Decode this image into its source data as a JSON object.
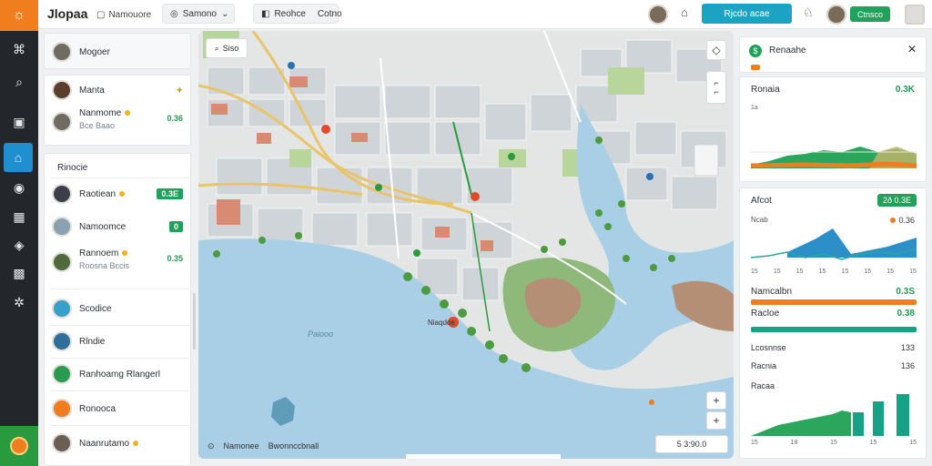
{
  "app": {
    "title": "Jlopaa"
  },
  "rail": {
    "icons": [
      "logo-icon",
      "network-icon",
      "search-icon",
      "inbox-icon",
      "home-icon",
      "chat-icon",
      "layout-icon",
      "location-icon",
      "grid-icon",
      "share-icon",
      "badge-icon"
    ]
  },
  "topbar": {
    "chip1": "Namouore",
    "pill1": "Samono",
    "pill2_a": "Reohce",
    "pill2_b": "Cotno",
    "cta": "Rjcdo acae",
    "status": "Ctnsco"
  },
  "list": {
    "pinned": {
      "name": "Mogoer"
    },
    "card2": [
      {
        "name": "Manta"
      },
      {
        "name": "Nanmome",
        "sub": "Bce Baao",
        "status": "0.36"
      }
    ],
    "section": "Rinocie",
    "rows": [
      {
        "name": "Raotiean",
        "status": "0.3E"
      },
      {
        "name": "Namoomce",
        "status": "0"
      },
      {
        "name": "Rannoem",
        "sub": "Roosna Bccis",
        "status": "0.35"
      },
      {
        "name": "Scodice"
      },
      {
        "name": "Rlndie"
      },
      {
        "name": "Ranhoamg Rlangerl"
      },
      {
        "name": "Ronooca"
      },
      {
        "name": "Naanrutamo"
      }
    ]
  },
  "map": {
    "search_label": "Siso",
    "water_label": "Paiooo",
    "marker_label": "Niaqdoe",
    "foot_a": "Namonee",
    "foot_b": "Bwonnccbnall",
    "scale": "5 3:90.0"
  },
  "panel": {
    "top": {
      "title": "Renaahe"
    },
    "chart1": {
      "title": "Ronaia",
      "value": "0.3K",
      "tick": "1a"
    },
    "chart2": {
      "title": "Afcot",
      "badge": "2ð 0.3E",
      "value": "0.36",
      "tick": "Ncab",
      "xticks": [
        "15",
        "15",
        "15",
        "15",
        "15",
        "15",
        "15",
        "15"
      ]
    },
    "m1": {
      "label": "Namcalbn",
      "value": "0.3S"
    },
    "m2": {
      "label": "Racloe",
      "value": "0.38"
    },
    "m3": {
      "label": "Lcosnnse",
      "value": "133"
    },
    "m4": {
      "label": "Racnia",
      "value": "136"
    },
    "chart3": {
      "title": "Racaa",
      "xticks": [
        "15",
        "18",
        "15",
        "15",
        "15"
      ]
    }
  },
  "colors": {
    "accent": "#f07d1e",
    "primary": "#1ba3c4",
    "success": "#21a15a",
    "rail": "#23272c"
  }
}
